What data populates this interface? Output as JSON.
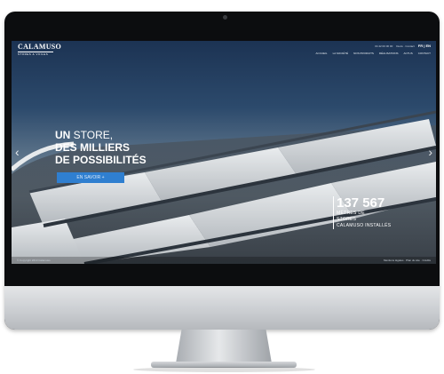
{
  "brand": {
    "name": "CALAMUSO",
    "tagline": "STORES & VOILES"
  },
  "topbar": {
    "phone": "04 42 00 00 00",
    "contact": "Devis · Contact",
    "lang": "FR | EN"
  },
  "nav": {
    "items": [
      "ACCUEIL",
      "LA SOCIÉTÉ",
      "NOS PRODUITS",
      "RÉALISATIONS",
      "ACTUS",
      "CONTACT"
    ]
  },
  "hero": {
    "line1_bold": "UN",
    "line1_light": " STORE,",
    "line2": "DES MILLIERS",
    "line3": "DE POSSIBILITÉS",
    "cta_label": "EN SAVOIR +",
    "prev_arrow": "‹",
    "next_arrow": "›"
  },
  "stat": {
    "value": "137 567",
    "line1": "MÈTRES DE",
    "line2": "STORES",
    "line3": "CALAMUSO INSTALLÉS"
  },
  "footer": {
    "left": "© Copyright 2019 Calamuso",
    "right": "Mentions légales · Plan du site · Crédits"
  },
  "colors": {
    "accent": "#2f7fd0",
    "sky": "#1c3353",
    "bezel": "#0c0d0f"
  }
}
